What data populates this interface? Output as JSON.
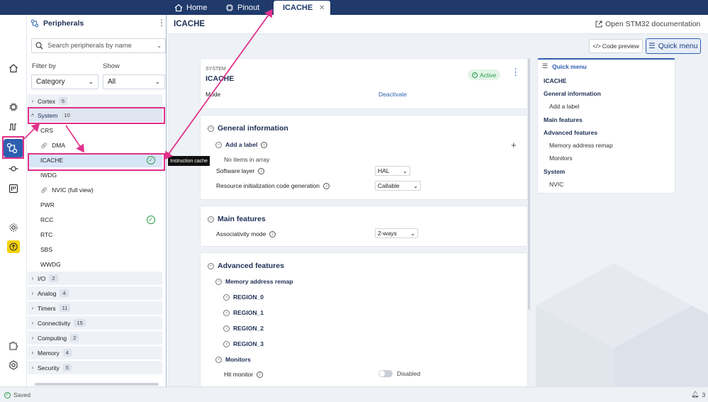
{
  "tabs": [
    {
      "label": "Home"
    },
    {
      "label": "Pinout"
    },
    {
      "label": "ICACHE"
    }
  ],
  "panel": {
    "title": "Peripherals",
    "search_placeholder": "Search peripherals by name",
    "filter_by_label": "Filter by",
    "show_label": "Show",
    "filter_value": "Category",
    "show_value": "All",
    "categories_top": [
      {
        "label": "Cortex",
        "count": "6"
      },
      {
        "label": "System",
        "count": "10"
      }
    ],
    "system_items": [
      "CRS",
      "DMA",
      "ICACHE",
      "IWDG",
      "NVIC (full view)",
      "PWR",
      "RCC",
      "RTC",
      "SBS",
      "WWDG"
    ],
    "categories_bottom": [
      {
        "label": "I/O",
        "count": "2"
      },
      {
        "label": "Analog",
        "count": "4"
      },
      {
        "label": "Timers",
        "count": "11"
      },
      {
        "label": "Connectivity",
        "count": "15"
      },
      {
        "label": "Computing",
        "count": "2"
      },
      {
        "label": "Memory",
        "count": "4"
      },
      {
        "label": "Security",
        "count": "5"
      }
    ],
    "tooltip": "Instruction cache"
  },
  "main": {
    "title": "ICACHE",
    "doc_link": "Open STM32 documentation",
    "code_preview": "Code preview",
    "quick_menu_button": "Quick menu",
    "system_label": "SYSTEM",
    "card_title": "ICACHE",
    "status": "Active",
    "mode_label": "Mode",
    "mode_value": "Deactivate",
    "general": {
      "title": "General information",
      "add_label": "Add a label",
      "empty": "No items in array",
      "software_layer_label": "Software layer",
      "software_layer_value": "HAL",
      "resource_label": "Resource initialization code generation",
      "resource_value": "Callable"
    },
    "main_features": {
      "title": "Main features",
      "assoc_label": "Associativity mode",
      "assoc_value": "2-ways"
    },
    "advanced": {
      "title": "Advanced features",
      "remap_title": "Memory address remap",
      "regions": [
        "REGION_0",
        "REGION_1",
        "REGION_2",
        "REGION_3"
      ],
      "monitors_title": "Monitors",
      "hit_monitor_label": "Hit monitor",
      "hit_monitor_value": "Disabled"
    }
  },
  "quick_menu": {
    "title": "Quick menu",
    "items": [
      {
        "label": "ICACHE",
        "level": 0
      },
      {
        "label": "General information",
        "level": 0
      },
      {
        "label": "Add a label",
        "level": 1
      },
      {
        "label": "Main features",
        "level": 0
      },
      {
        "label": "Advanced features",
        "level": 0
      },
      {
        "label": "Memory address remap",
        "level": 1
      },
      {
        "label": "Monitors",
        "level": 1
      },
      {
        "label": "System",
        "level": 0
      },
      {
        "label": "NVIC",
        "level": 1
      }
    ]
  },
  "statusbar": {
    "saved": "Saved",
    "notifications": "3"
  },
  "colors": {
    "nav": "#1f3a6b",
    "accent": "#2d5fb0",
    "highlight": "#e0318a",
    "success": "#2a9d4a"
  }
}
